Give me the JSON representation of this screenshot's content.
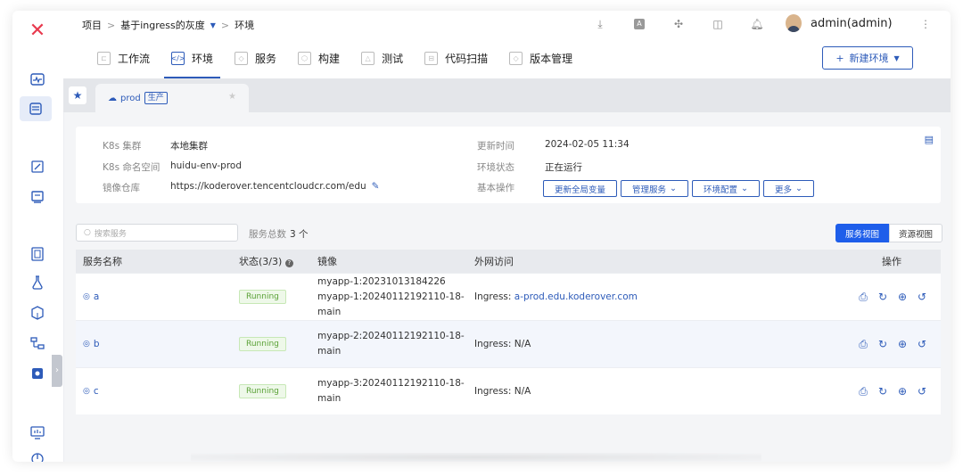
{
  "breadcrumb": {
    "project": "项目",
    "sep1": ">",
    "project_name": "基于ingress的灰度",
    "sep2": ">",
    "current": "环境"
  },
  "user": {
    "name": "admin(admin)"
  },
  "tabs": [
    {
      "label": "工作流",
      "icon": "workflow-icon"
    },
    {
      "label": "环境",
      "icon": "code-icon"
    },
    {
      "label": "服务",
      "icon": "cube-icon"
    },
    {
      "label": "构建",
      "icon": "hex-icon"
    },
    {
      "label": "测试",
      "icon": "flask-icon"
    },
    {
      "label": "代码扫描",
      "icon": "scan-icon"
    },
    {
      "label": "版本管理",
      "icon": "version-icon"
    }
  ],
  "new_env_button": "新建环境",
  "env_tab": {
    "name": "prod",
    "badge": "生产"
  },
  "info": {
    "cluster_label": "K8s 集群",
    "cluster_value": "本地集群",
    "namespace_label": "K8s 命名空间",
    "namespace_value": "huidu-env-prod",
    "registry_label": "镜像仓库",
    "registry_value": "https://koderover.tencentcloudcr.com/edu",
    "updated_label": "更新时间",
    "updated_value": "2024-02-05 11:34",
    "status_label": "环境状态",
    "status_value": "正在运行",
    "ops_label": "基本操作",
    "ops": [
      "更新全局变量",
      "管理服务",
      "环境配置",
      "更多"
    ]
  },
  "search": {
    "placeholder": "搜索服务"
  },
  "service_count": {
    "label": "服务总数",
    "value": "3 个"
  },
  "views": {
    "service": "服务视图",
    "resource": "资源视图"
  },
  "table": {
    "headers": {
      "name": "服务名称",
      "status": "状态(3/3)",
      "image": "镜像",
      "access": "外网访问",
      "actions": "操作"
    },
    "rows": [
      {
        "name": "a",
        "status": "Running",
        "image1": "myapp-1:20231013184226",
        "image2": "myapp-1:20240112192110-18-main",
        "access_prefix": "Ingress: ",
        "access_value": "a-prod.edu.koderover.com"
      },
      {
        "name": "b",
        "status": "Running",
        "image1": "myapp-2:20240112192110-18-main",
        "image2": "",
        "access_prefix": "Ingress: N/A",
        "access_value": ""
      },
      {
        "name": "c",
        "status": "Running",
        "image1": "myapp-3:20240112192110-18-main",
        "image2": "",
        "access_prefix": "Ingress: N/A",
        "access_value": ""
      }
    ]
  },
  "colors": {
    "accent": "#2d5bb9",
    "brand": "#e83a4e",
    "running": "#5aa136"
  }
}
